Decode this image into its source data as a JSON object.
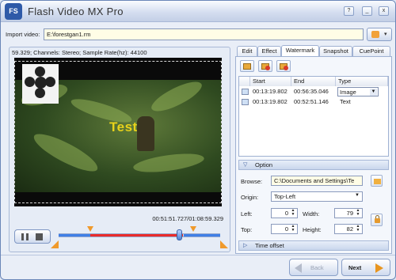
{
  "app": {
    "logo_text": "FS",
    "title": "Flash Video MX Pro"
  },
  "titlebar": {
    "help_icon": "?",
    "minimize_icon": "_",
    "close_icon": "x"
  },
  "import": {
    "label": "Import video:",
    "value": "E:\\forestgan1.rm",
    "dropdown_icon": "▾"
  },
  "preview": {
    "info": "59.329; Channels: Stereo; Sample Rate(hz): 44100",
    "watermark_text": "Test",
    "timecode": "00:51:51.727/01:08:59.329",
    "progress_position": 0.66,
    "range_start": 0.2,
    "range_end": 0.77
  },
  "tabs": [
    {
      "label": "Edit"
    },
    {
      "label": "Effect"
    },
    {
      "label": "Watermark"
    },
    {
      "label": "Snapshot"
    },
    {
      "label": "CuePoint"
    }
  ],
  "active_tab": "Watermark",
  "watermark_table": {
    "columns": [
      "Start",
      "End",
      "Type"
    ],
    "rows": [
      {
        "start": "00:13:19.802",
        "end": "00:56:35.046",
        "type": "Image"
      },
      {
        "start": "00:13:19.802",
        "end": "00:52:51.146",
        "type": "Text"
      }
    ]
  },
  "option": {
    "header": "Option",
    "browse_label": "Browse:",
    "browse_value": "C:\\Documents and Settings\\Te",
    "origin_label": "Origin:",
    "origin_value": "Top-Left",
    "left_label": "Left:",
    "left_value": "0",
    "width_label": "Width:",
    "width_value": "79",
    "top_label": "Top:",
    "top_value": "0",
    "height_label": "Height:",
    "height_value": "82"
  },
  "time_offset": {
    "header": "Time offset"
  },
  "nav": {
    "back_label": "Back",
    "next_label": "Next"
  },
  "colors": {
    "accent": "#3f7fe6",
    "range": "#ea2b2b",
    "marker": "#f09a2b",
    "watermark_text": "#e8d21a"
  }
}
